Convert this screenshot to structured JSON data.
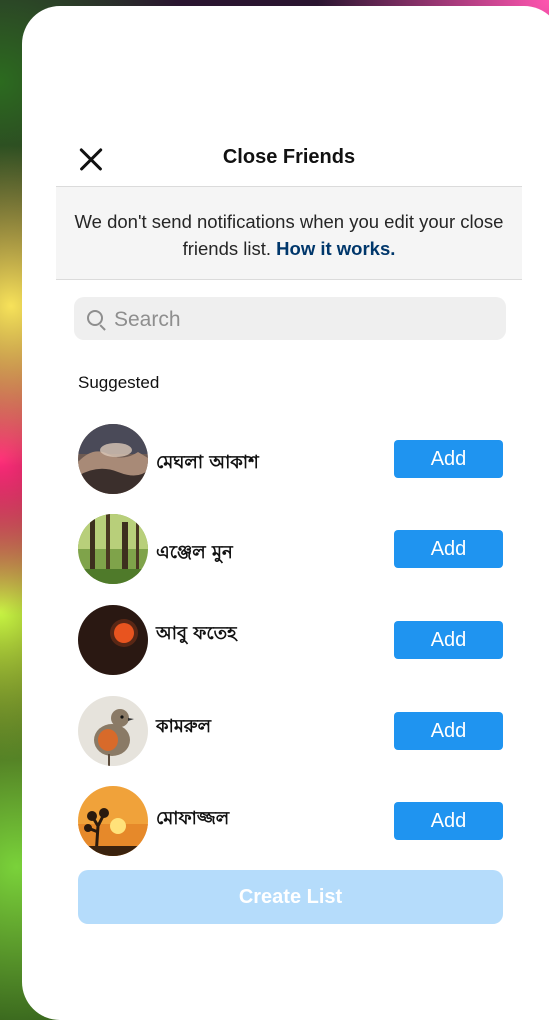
{
  "header": {
    "title": "Close Friends"
  },
  "notice": {
    "text": "We don't send notifications when you edit your close friends list.",
    "link": "How it works."
  },
  "search": {
    "placeholder": "Search"
  },
  "section_label": "Suggested",
  "friends": [
    {
      "name": "মেঘলা আকাশ",
      "action": "Add",
      "avatar": "clouds-photo"
    },
    {
      "name": "এঞ্জেল মুন",
      "action": "Add",
      "avatar": "forest-photo"
    },
    {
      "name": "আবু ফতেহ",
      "action": "Add",
      "avatar": "red-sun-photo"
    },
    {
      "name": "কামরুল",
      "action": "Add",
      "avatar": "robin-bird-photo"
    },
    {
      "name": "মোফাজ্জল",
      "action": "Add",
      "avatar": "sunset-tree-photo"
    }
  ],
  "footer": {
    "create_label": "Create List"
  },
  "colors": {
    "accent": "#1f94f0",
    "link": "#00376b",
    "disabled": "#b5dcfb"
  }
}
